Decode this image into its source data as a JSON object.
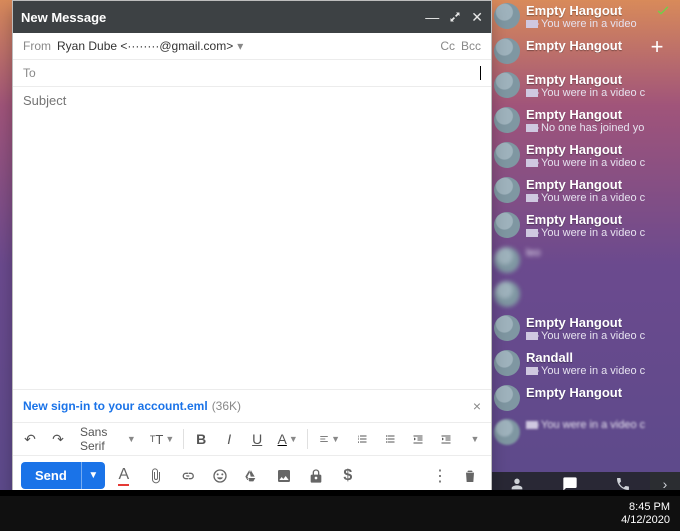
{
  "compose": {
    "title": "New Message",
    "from_label": "From",
    "from_value": "Ryan Dube <········@gmail.com>",
    "cc_label": "Cc",
    "bcc_label": "Bcc",
    "to_label": "To",
    "to_value": "",
    "subject_placeholder": "Subject",
    "subject_value": "",
    "attachment": {
      "name": "New sign-in to your account.eml",
      "size": "(36K)"
    },
    "font_family": "Sans Serif",
    "send_label": "Send"
  },
  "hangouts": {
    "items": [
      {
        "title": "Empty Hangout",
        "sub": "You were in a video"
      },
      {
        "title": "Empty Hangout",
        "sub": ""
      },
      {
        "title": "Empty Hangout",
        "sub": "You were in a video c"
      },
      {
        "title": "Empty Hangout",
        "sub": "No one has joined yo"
      },
      {
        "title": "Empty Hangout",
        "sub": "You were in a video c"
      },
      {
        "title": "Empty Hangout",
        "sub": "You were in a video c"
      },
      {
        "title": "Empty Hangout",
        "sub": "You were in a video c"
      },
      {
        "title": "",
        "sub": "leo"
      },
      {
        "title": "",
        "sub": ""
      },
      {
        "title": "Empty Hangout",
        "sub": "You were in a video c"
      },
      {
        "title": "Randall",
        "sub": "You were in a video c"
      },
      {
        "title": "Empty Hangout",
        "sub": ""
      },
      {
        "title": "",
        "sub": "You were in a video c"
      }
    ]
  },
  "taskbar": {
    "time": "8:45 PM",
    "date": "4/12/2020"
  }
}
